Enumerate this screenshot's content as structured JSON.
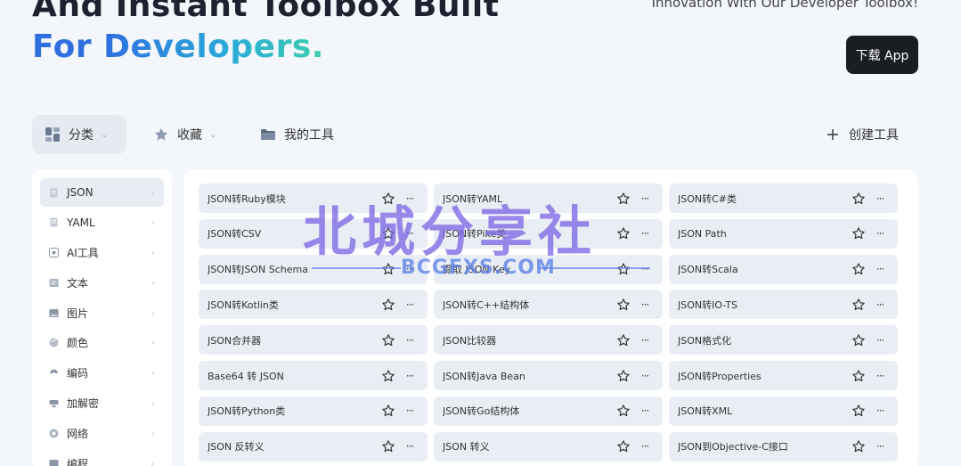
{
  "hero": {
    "line1": "And Instant Toolbox Built",
    "line2_part1": "For ",
    "line2_part2": "Developers.",
    "tagline": "Innovation With Our Developer Toolbox!",
    "download_label": "下载 App"
  },
  "toolbar": {
    "category_label": "分类",
    "favorites_label": "收藏",
    "my_tools_label": "我的工具",
    "create_label": "创建工具"
  },
  "sidebar": {
    "items": [
      {
        "label": "JSON",
        "icon": "document-icon"
      },
      {
        "label": "YAML",
        "icon": "document-icon"
      },
      {
        "label": "AI工具",
        "icon": "ai-icon"
      },
      {
        "label": "文本",
        "icon": "text-icon"
      },
      {
        "label": "图片",
        "icon": "image-icon"
      },
      {
        "label": "颜色",
        "icon": "palette-icon"
      },
      {
        "label": "编码",
        "icon": "code-icon"
      },
      {
        "label": "加解密",
        "icon": "lock-icon"
      },
      {
        "label": "网络",
        "icon": "globe-icon"
      },
      {
        "label": "编程",
        "icon": "terminal-icon"
      }
    ]
  },
  "tools": [
    [
      "JSON转Ruby模块",
      "JSON转YAML",
      "JSON转C#类"
    ],
    [
      "JSON转CSV",
      "JSON转Pike类",
      "JSON Path"
    ],
    [
      "JSON转JSON Schema",
      "提取 JSON Key",
      "JSON转Scala"
    ],
    [
      "JSON转Kotlin类",
      "JSON转C++结构体",
      "JSON转IO-TS"
    ],
    [
      "JSON合并器",
      "JSON比较器",
      "JSON格式化"
    ],
    [
      "Base64 转 JSON",
      "JSON转Java Bean",
      "JSON转Properties"
    ],
    [
      "JSON转Python类",
      "JSON转Go结构体",
      "JSON转XML"
    ],
    [
      "JSON 反转义",
      "JSON 转义",
      "JSON到Objective-C接口"
    ]
  ],
  "more_glyph": "···",
  "watermark": {
    "title": "北城分享社",
    "subtitle": "BCGFXS.COM"
  },
  "colors": {
    "page_bg": "#f3f6fa",
    "accent_blue": "#2f6fe0",
    "accent_teal": "#3ccfb0",
    "card_bg": "#e9eef5",
    "dark_button": "#1a1d22"
  }
}
